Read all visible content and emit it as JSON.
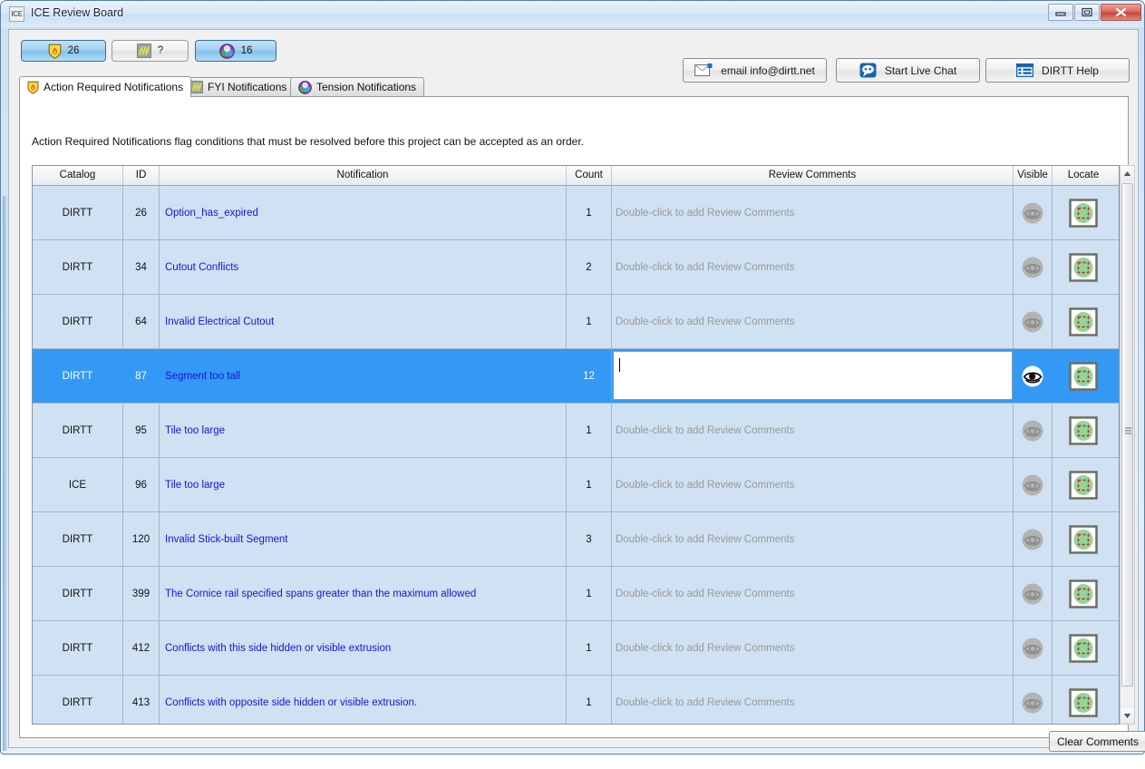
{
  "window": {
    "title": "ICE Review Board",
    "app_icon_label": "ICE",
    "controls": {
      "minimize": "minimize-button",
      "maximize": "maximize-button",
      "close": "close-button"
    }
  },
  "toolbar": {
    "badges": [
      {
        "id": "action",
        "icon": "shield-flame-icon",
        "count": "26",
        "active": true
      },
      {
        "id": "fyi",
        "icon": "fyi-icon",
        "count": "?",
        "active": false
      },
      {
        "id": "tension",
        "icon": "tension-icon",
        "count": "16",
        "active": true
      }
    ],
    "actions": [
      {
        "id": "email",
        "icon": "envelope-icon",
        "label": "email info@dirtt.net"
      },
      {
        "id": "chat",
        "icon": "chat-bubble-icon",
        "label": "Start Live Chat"
      },
      {
        "id": "help",
        "icon": "grid-table-icon",
        "label": "DIRTT Help"
      }
    ]
  },
  "tabs": [
    {
      "id": "action",
      "icon": "shield-flame-icon",
      "label": "Action Required Notifications",
      "active": true
    },
    {
      "id": "fyi",
      "icon": "fyi-icon",
      "label": "FYI Notifications",
      "active": false
    },
    {
      "id": "tension",
      "icon": "tension-icon",
      "label": "Tension Notifications",
      "active": false
    }
  ],
  "panel": {
    "description": "Action Required Notifications flag conditions that must be resolved before this project can be accepted as an order."
  },
  "grid": {
    "columns": [
      {
        "key": "catalog",
        "label": "Catalog"
      },
      {
        "key": "id",
        "label": "ID"
      },
      {
        "key": "notification",
        "label": "Notification"
      },
      {
        "key": "count",
        "label": "Count"
      },
      {
        "key": "comments",
        "label": "Review Comments"
      },
      {
        "key": "visible",
        "label": "Visible"
      },
      {
        "key": "locate",
        "label": "Locate"
      }
    ],
    "comment_placeholder": "Double-click to add Review Comments",
    "editor_value": "",
    "rows": [
      {
        "catalog": "DIRTT",
        "id": "26",
        "notification": "Option_has_expired",
        "count": "1",
        "comments": "",
        "selected": false
      },
      {
        "catalog": "DIRTT",
        "id": "34",
        "notification": "Cutout Conflicts",
        "count": "2",
        "comments": "",
        "selected": false
      },
      {
        "catalog": "DIRTT",
        "id": "64",
        "notification": "Invalid Electrical Cutout",
        "count": "1",
        "comments": "",
        "selected": false
      },
      {
        "catalog": "DIRTT",
        "id": "87",
        "notification": "Segment too tall",
        "count": "12",
        "comments": "",
        "selected": true
      },
      {
        "catalog": "DIRTT",
        "id": "95",
        "notification": "Tile too large",
        "count": "1",
        "comments": "",
        "selected": false
      },
      {
        "catalog": "ICE",
        "id": "96",
        "notification": "Tile too large",
        "count": "1",
        "comments": "",
        "selected": false
      },
      {
        "catalog": "DIRTT",
        "id": "120",
        "notification": "Invalid Stick-built Segment",
        "count": "3",
        "comments": "",
        "selected": false
      },
      {
        "catalog": "DIRTT",
        "id": "399",
        "notification": "The Cornice rail specified spans greater than the maximum allowed",
        "count": "1",
        "comments": "",
        "selected": false
      },
      {
        "catalog": "DIRTT",
        "id": "412",
        "notification": "Conflicts with this side hidden or visible extrusion",
        "count": "1",
        "comments": "",
        "selected": false
      },
      {
        "catalog": "DIRTT",
        "id": "413",
        "notification": "Conflicts with opposite side hidden or visible extrusion.",
        "count": "1",
        "comments": "",
        "selected": false
      }
    ]
  },
  "footer": {
    "clear_comments_label": "Clear Comments"
  },
  "colors": {
    "row_background": "#cfe1f2",
    "row_selected": "#3399f5",
    "link_text": "#1515d8",
    "placeholder_text": "#9a9a9a",
    "window_chrome": "#cfe0f2",
    "close_button": "#c6453b",
    "locate_green": "#8fd69a",
    "locate_marker_red": "#cc2222"
  }
}
